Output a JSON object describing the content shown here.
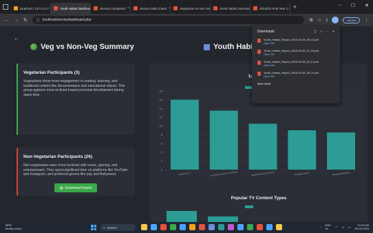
{
  "browser": {
    "tabs": [
      {
        "title": "localhost / 127.0.0.1 / ...",
        "color": "#f4a21b"
      },
      {
        "title": "Youth Habits Dashboard",
        "color": "#e8503a",
        "active": true
      },
      {
        "title": "Survey Completed",
        "color": "#e8503a"
      },
      {
        "title": "Survey Data Charts",
        "color": "#e8503a"
      },
      {
        "title": "Vegetarian vs Non-Veg",
        "color": "#e8503a"
      },
      {
        "title": "Youth Habits Summary",
        "color": "#e8503a"
      },
      {
        "title": "2024/25 Final Year C...",
        "color": "#e8503a"
      }
    ],
    "url": "localhost/survey/dashboard.php",
    "update_label": "Update"
  },
  "page": {
    "left_title": "Veg vs Non-Veg Summary",
    "right_title": "Youth Habit",
    "veg_card": {
      "heading": "Vegetarian Participants (3)",
      "body": "Vegetarians show more engagement in reading, learning, and traditional content like documentaries and educational videos. This group appears more inclined toward personal development during spare time."
    },
    "nonveg_card": {
      "heading": "Non-Vegetarian Participants (26)",
      "body": "Non-vegetarians were more involved with music, gaming, and entertainment. They spent significant time on platforms like YouTube and Instagram, and preferred genres like pop and Bollywood."
    },
    "download_button": "Download Report",
    "chart2_title": "Popular TV Content Types"
  },
  "chart_data": [
    {
      "type": "bar",
      "title": "Top Spare",
      "categories": [
        "Watching TV",
        "Listening to music / podcasts",
        "Watching movies/series",
        "Reading books",
        "Sleeping/Relaxing"
      ],
      "values": [
        16,
        13.5,
        10.5,
        9,
        8.5
      ],
      "ylim": [
        0,
        18
      ],
      "yticks": [
        "0",
        "2",
        "4",
        "6",
        "8",
        "10",
        "12",
        "14",
        "16",
        "18"
      ],
      "color": "#2c9c95",
      "grid": true
    },
    {
      "type": "bar",
      "title": "Popular TV Content Types",
      "categories": [],
      "values": [],
      "color": "#2c9c95"
    }
  ],
  "downloads": {
    "title": "Downloads",
    "items": [
      {
        "name": "Youth_Habits_Report_2025-03-06_09-15.pdf",
        "action": "Open file"
      },
      {
        "name": "Youth_Habits_Report_2025-03-06_12-19.pdf",
        "action": "Open file"
      },
      {
        "name": "Youth_Habits_Report_2025-03-06_04-14.pdf",
        "action": "Open file"
      },
      {
        "name": "Youth_Habits_Report_2025-03-06_09-21.pdf",
        "action": "Open file"
      }
    ],
    "see_more": "See more"
  },
  "taskbar": {
    "weather_temp": "29°C",
    "weather_desc": "Mostly sunny",
    "search_placeholder": "Search",
    "lang": "ENG\nIN",
    "time": "12:03 AM",
    "date": "06-03-2025",
    "icon_colors": [
      "#f2c94c",
      "#4fa3ff",
      "#e8503a",
      "#3aa84a",
      "#4fa3ff",
      "#f4a21b",
      "#e05245",
      "#6c8ed6",
      "#2c9c95",
      "#c05ad0",
      "#4fa3ff",
      "#3aa84a",
      "#e8503a",
      "#4fa3ff",
      "#f2c94c"
    ]
  }
}
